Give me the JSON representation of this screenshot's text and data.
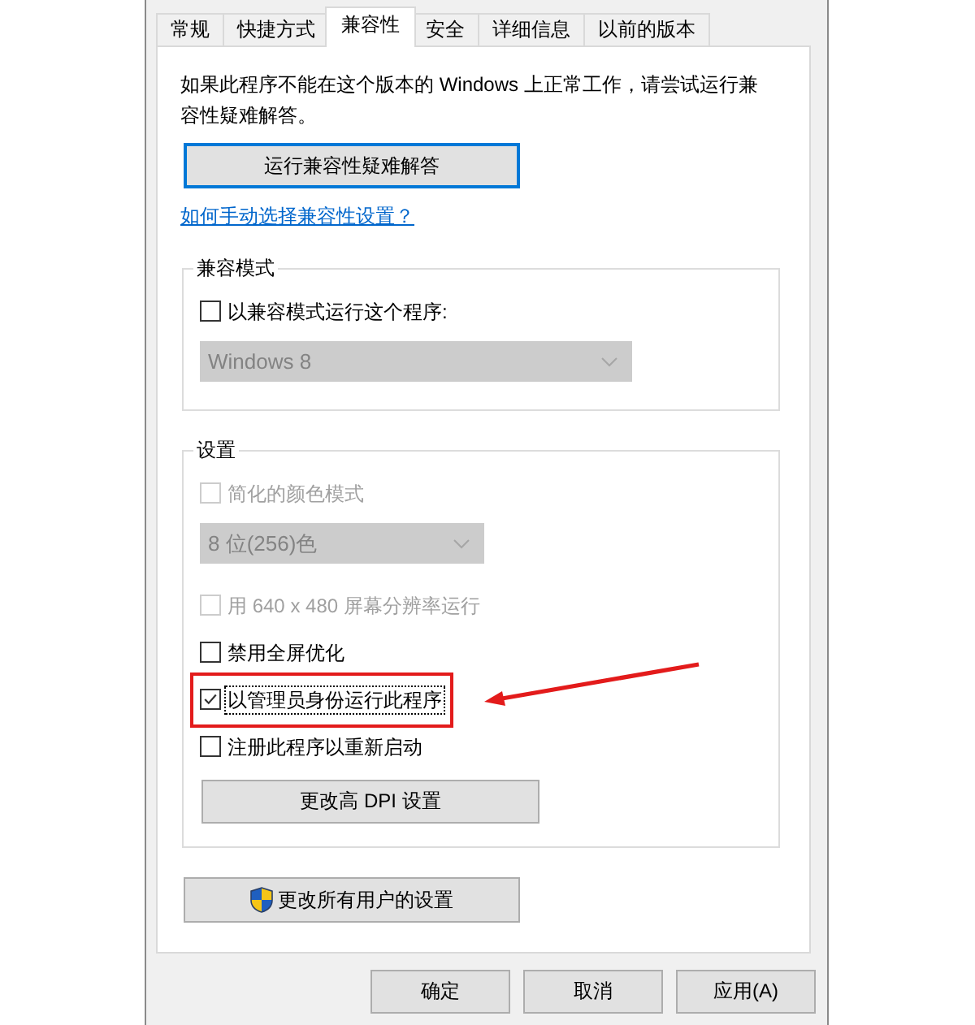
{
  "tabs": [
    {
      "label": "常规",
      "selected": false
    },
    {
      "label": "快捷方式",
      "selected": false
    },
    {
      "label": "兼容性",
      "selected": true
    },
    {
      "label": "安全",
      "selected": false
    },
    {
      "label": "详细信息",
      "selected": false
    },
    {
      "label": "以前的版本",
      "selected": false
    }
  ],
  "intro": "如果此程序不能在这个版本的 Windows 上正常工作，请尝试运行兼容性疑难解答。",
  "troubleshoot_button": {
    "label": "运行兼容性疑难解答",
    "default": true
  },
  "help_link": "如何手动选择兼容性设置？",
  "compat_mode": {
    "title": "兼容模式",
    "items": [
      {
        "kind": "checkbox",
        "label": "以兼容模式运行这个程序:",
        "checked": false,
        "disabled": false,
        "focused": false,
        "highlighted": false
      },
      {
        "kind": "dropdown",
        "value": "Windows 8",
        "disabled": true
      }
    ]
  },
  "settings": {
    "title": "设置",
    "items": [
      {
        "kind": "checkbox",
        "label": "简化的颜色模式",
        "checked": false,
        "disabled": true,
        "focused": false,
        "highlighted": false
      },
      {
        "kind": "dropdown",
        "value": "8 位(256)色",
        "disabled": true
      },
      {
        "kind": "checkbox",
        "label": "用 640 x 480 屏幕分辨率运行",
        "checked": false,
        "disabled": true,
        "focused": false,
        "highlighted": false
      },
      {
        "kind": "checkbox",
        "label": "禁用全屏优化",
        "checked": false,
        "disabled": false,
        "focused": false,
        "highlighted": false
      },
      {
        "kind": "checkbox",
        "label": "以管理员身份运行此程序",
        "checked": true,
        "disabled": false,
        "focused": true,
        "highlighted": true
      },
      {
        "kind": "checkbox",
        "label": "注册此程序以重新启动",
        "checked": false,
        "disabled": false,
        "focused": false,
        "highlighted": false
      },
      {
        "kind": "button",
        "label": "更改高 DPI 设置",
        "default": false
      }
    ]
  },
  "all_users_button": {
    "label": "更改所有用户的设置",
    "default": false
  },
  "buttons": [
    {
      "label": "确定",
      "default": false
    },
    {
      "label": "取消",
      "default": false
    },
    {
      "label": "应用(A)",
      "default": false
    }
  ]
}
